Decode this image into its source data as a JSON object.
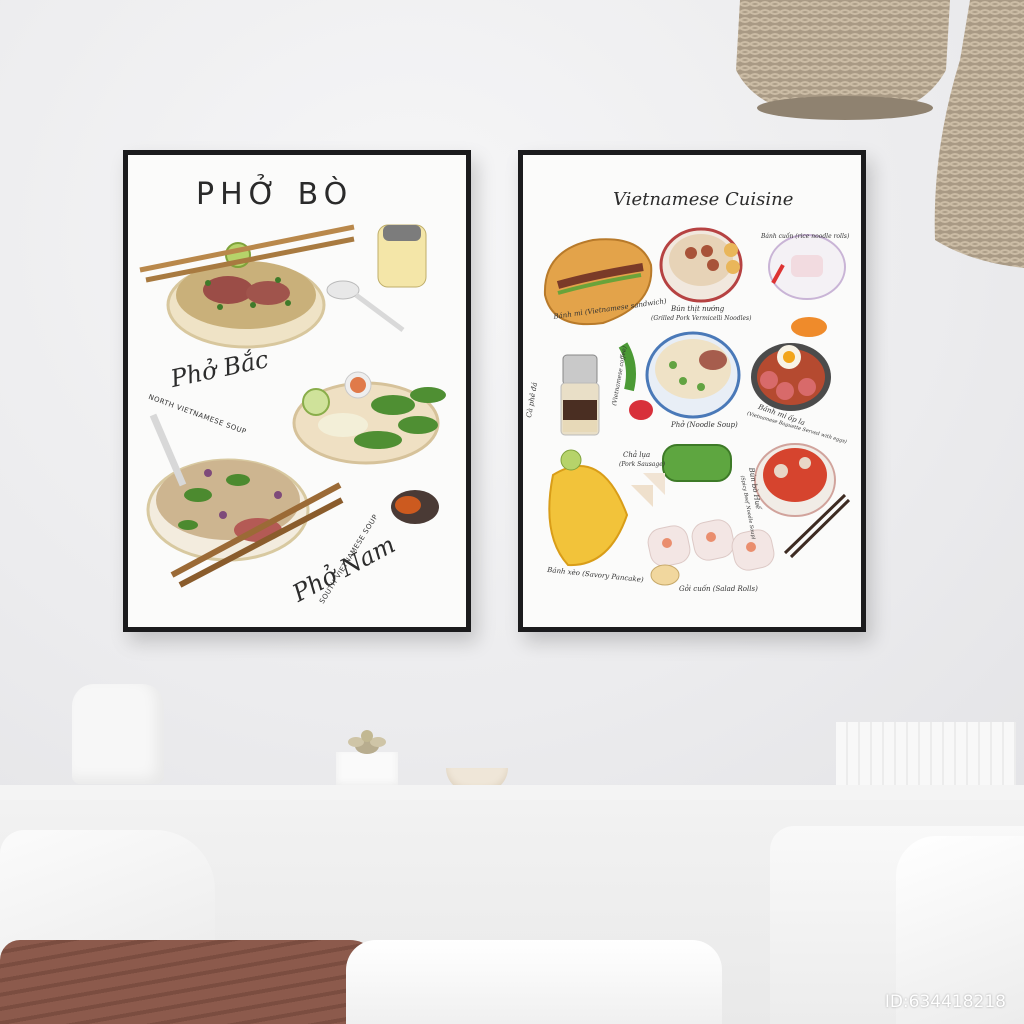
{
  "left_poster": {
    "title": "PHỞ BÒ",
    "label_north": "Phở Bắc",
    "sub_north": "NORTH VIETNAMESE SOUP",
    "label_south": "Phở Nam",
    "sub_south": "SOUTH VIETNAMESE SOUP"
  },
  "right_poster": {
    "title": "Vietnamese Cuisine",
    "items": {
      "banh_mi": "Bánh mì (Vietnamese sandwich)",
      "bun_thit_nuong": "Bún thịt nướng",
      "bun_thit_nuong_sub": "(Grilled Pork Vermicelli Noodles)",
      "banh_cuon": "Bánh cuốn (rice noodle rolls)",
      "ca_phe_da": "Cà phê đá",
      "ca_phe_sub": "(Vietnamese coffee)",
      "pho": "Phở (Noodle Soup)",
      "banh_mi_op_la": "Bánh mì ốp la",
      "banh_mi_op_la_sub": "(Vietnamese Baguette Served with eggs)",
      "cha_lua": "Chả lụa",
      "cha_lua_sub": "(Pork Sausage)",
      "bun_bo_hue": "Bún bò Huế",
      "bun_bo_hue_sub": "(Spicy Beef Noodle Soup)",
      "banh_xeo": "Bánh xèo (Savory Pancake)",
      "goi_cuon": "Gỏi cuốn (Salad Rolls)"
    }
  },
  "watermark": "ID:634418218"
}
